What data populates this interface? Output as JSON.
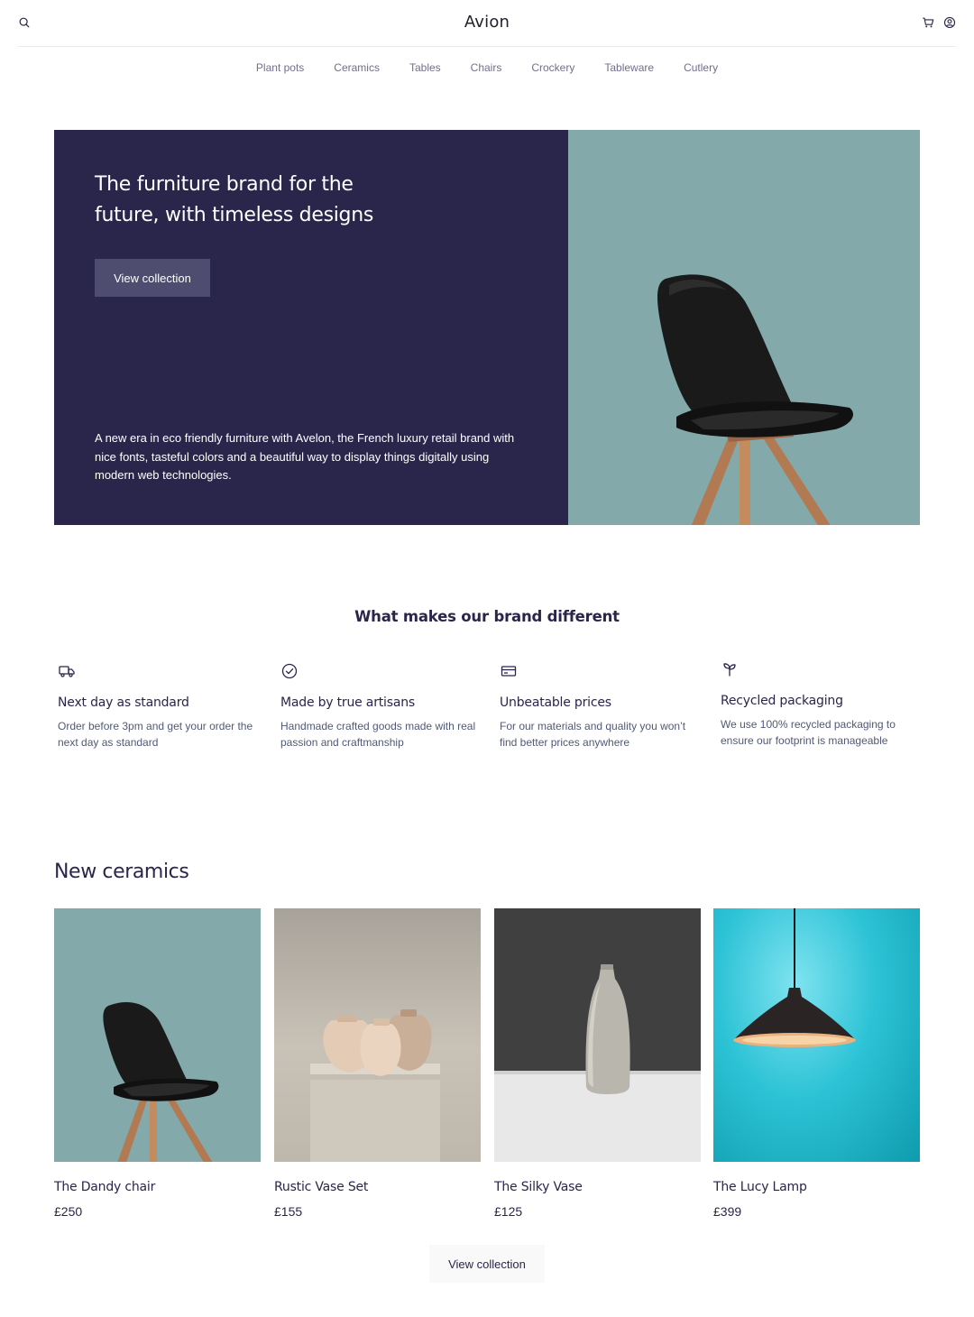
{
  "header": {
    "brand": "Avion",
    "search_icon": "search-icon",
    "cart_icon": "cart-icon",
    "user_icon": "user-icon"
  },
  "nav": {
    "items": [
      "Plant pots",
      "Ceramics",
      "Tables",
      "Chairs",
      "Crockery",
      "Tableware",
      "Cutlery"
    ]
  },
  "hero": {
    "title": "The furniture brand for the future, with timeless designs",
    "cta": "View collection",
    "description": "A new era in eco friendly furniture with Avelon, the French luxury retail brand with nice fonts, tasteful colors and a beautiful way to display things digitally using modern web technologies.",
    "colors": {
      "dark": "#2A254B",
      "image_bg": "#83A9AB",
      "button": "#4E4D6F"
    }
  },
  "features": {
    "title": "What makes our brand different",
    "items": [
      {
        "icon": "delivery-truck-icon",
        "title": "Next day as standard",
        "text": "Order before 3pm and get your order the next day as standard"
      },
      {
        "icon": "check-circle-icon",
        "title": "Made by true artisans",
        "text": "Handmade crafted goods made with real passion and craftmanship"
      },
      {
        "icon": "credit-card-icon",
        "title": "Unbeatable prices",
        "text": "For our materials and quality you won’t find better prices anywhere"
      },
      {
        "icon": "sprout-icon",
        "title": "Recycled packaging",
        "text": "We use 100% recycled packaging to ensure our footprint is manageable"
      }
    ]
  },
  "ceramics": {
    "title": "New ceramics",
    "products": [
      {
        "name": "The Dandy chair",
        "price": "£250"
      },
      {
        "name": "Rustic Vase Set",
        "price": "£155"
      },
      {
        "name": "The Silky Vase",
        "price": "£125"
      },
      {
        "name": "The Lucy Lamp",
        "price": "£399"
      }
    ],
    "cta": "View collection"
  }
}
